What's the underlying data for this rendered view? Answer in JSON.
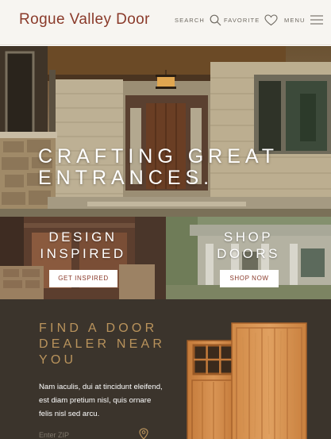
{
  "header": {
    "logo": "Rogue Valley Door",
    "search_label": "SEARCH",
    "favorite_label": "FAVORITE",
    "menu_label": "MENU"
  },
  "hero": {
    "title_line1": "CRAFTING GREAT",
    "title_line2": "ENTRANCES."
  },
  "panels": [
    {
      "title_line1": "DESIGN",
      "title_line2": "INSPIRED",
      "button": "GET INSPIRED"
    },
    {
      "title_line1": "SHOP",
      "title_line2": "DOORS",
      "button": "SHOP NOW"
    }
  ],
  "dealer": {
    "title_line1": "FIND A DOOR",
    "title_line2": "DEALER NEAR",
    "title_line3": "YOU",
    "body_line1": "Nam iaculis, dui at tincidunt eleifend,",
    "body_line2": "est diam pretium nisl, quis ornare",
    "body_line3": "felis nisl sed arcu.",
    "zip_placeholder": "Enter ZIP"
  },
  "colors": {
    "brand": "#8a3a2a",
    "gold": "#b9935c",
    "dark": "#3b342c",
    "header_bg": "#f7f5f1"
  }
}
